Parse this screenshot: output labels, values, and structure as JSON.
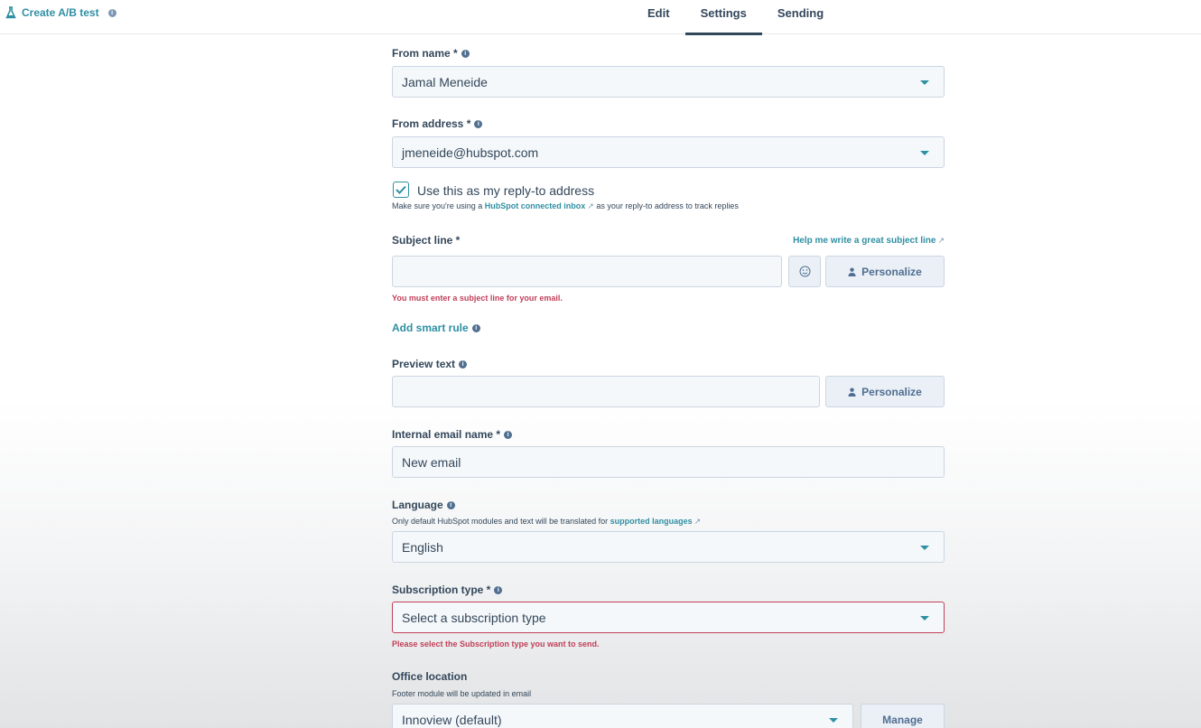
{
  "header": {
    "ab_test_label": "Create A/B test",
    "tabs": [
      {
        "label": "Edit",
        "active": false
      },
      {
        "label": "Settings",
        "active": true
      },
      {
        "label": "Sending",
        "active": false
      }
    ]
  },
  "form": {
    "from_name": {
      "label": "From name *",
      "value": "Jamal Meneide"
    },
    "from_address": {
      "label": "From address *",
      "value": "jmeneide@hubspot.com"
    },
    "reply_to": {
      "checked": true,
      "label": "Use this as my reply-to address",
      "help_prefix": "Make sure you're using a",
      "help_link": "HubSpot connected inbox",
      "help_suffix": "as your reply-to address to track replies"
    },
    "subject_line": {
      "label": "Subject line *",
      "help_link": "Help me write a great subject line",
      "value": "",
      "error": "You must enter a subject line for your email.",
      "personalize_label": "Personalize"
    },
    "smart_rule_label": "Add smart rule",
    "preview_text": {
      "label": "Preview text",
      "value": "",
      "personalize_label": "Personalize"
    },
    "internal_name": {
      "label": "Internal email name *",
      "value": "New email"
    },
    "language": {
      "label": "Language",
      "help_prefix": "Only default HubSpot modules and text will be translated for",
      "help_link": "supported languages",
      "value": "English"
    },
    "subscription_type": {
      "label": "Subscription type *",
      "value": "Select a subscription type",
      "error": "Please select the Subscription type you want to send."
    },
    "office_location": {
      "label": "Office location",
      "help": "Footer module will be updated in email",
      "value": "Innoview (default)",
      "manage_label": "Manage"
    }
  },
  "colors": {
    "accent": "#2f8fa3",
    "error": "#c1405a",
    "text": "#33475b"
  }
}
